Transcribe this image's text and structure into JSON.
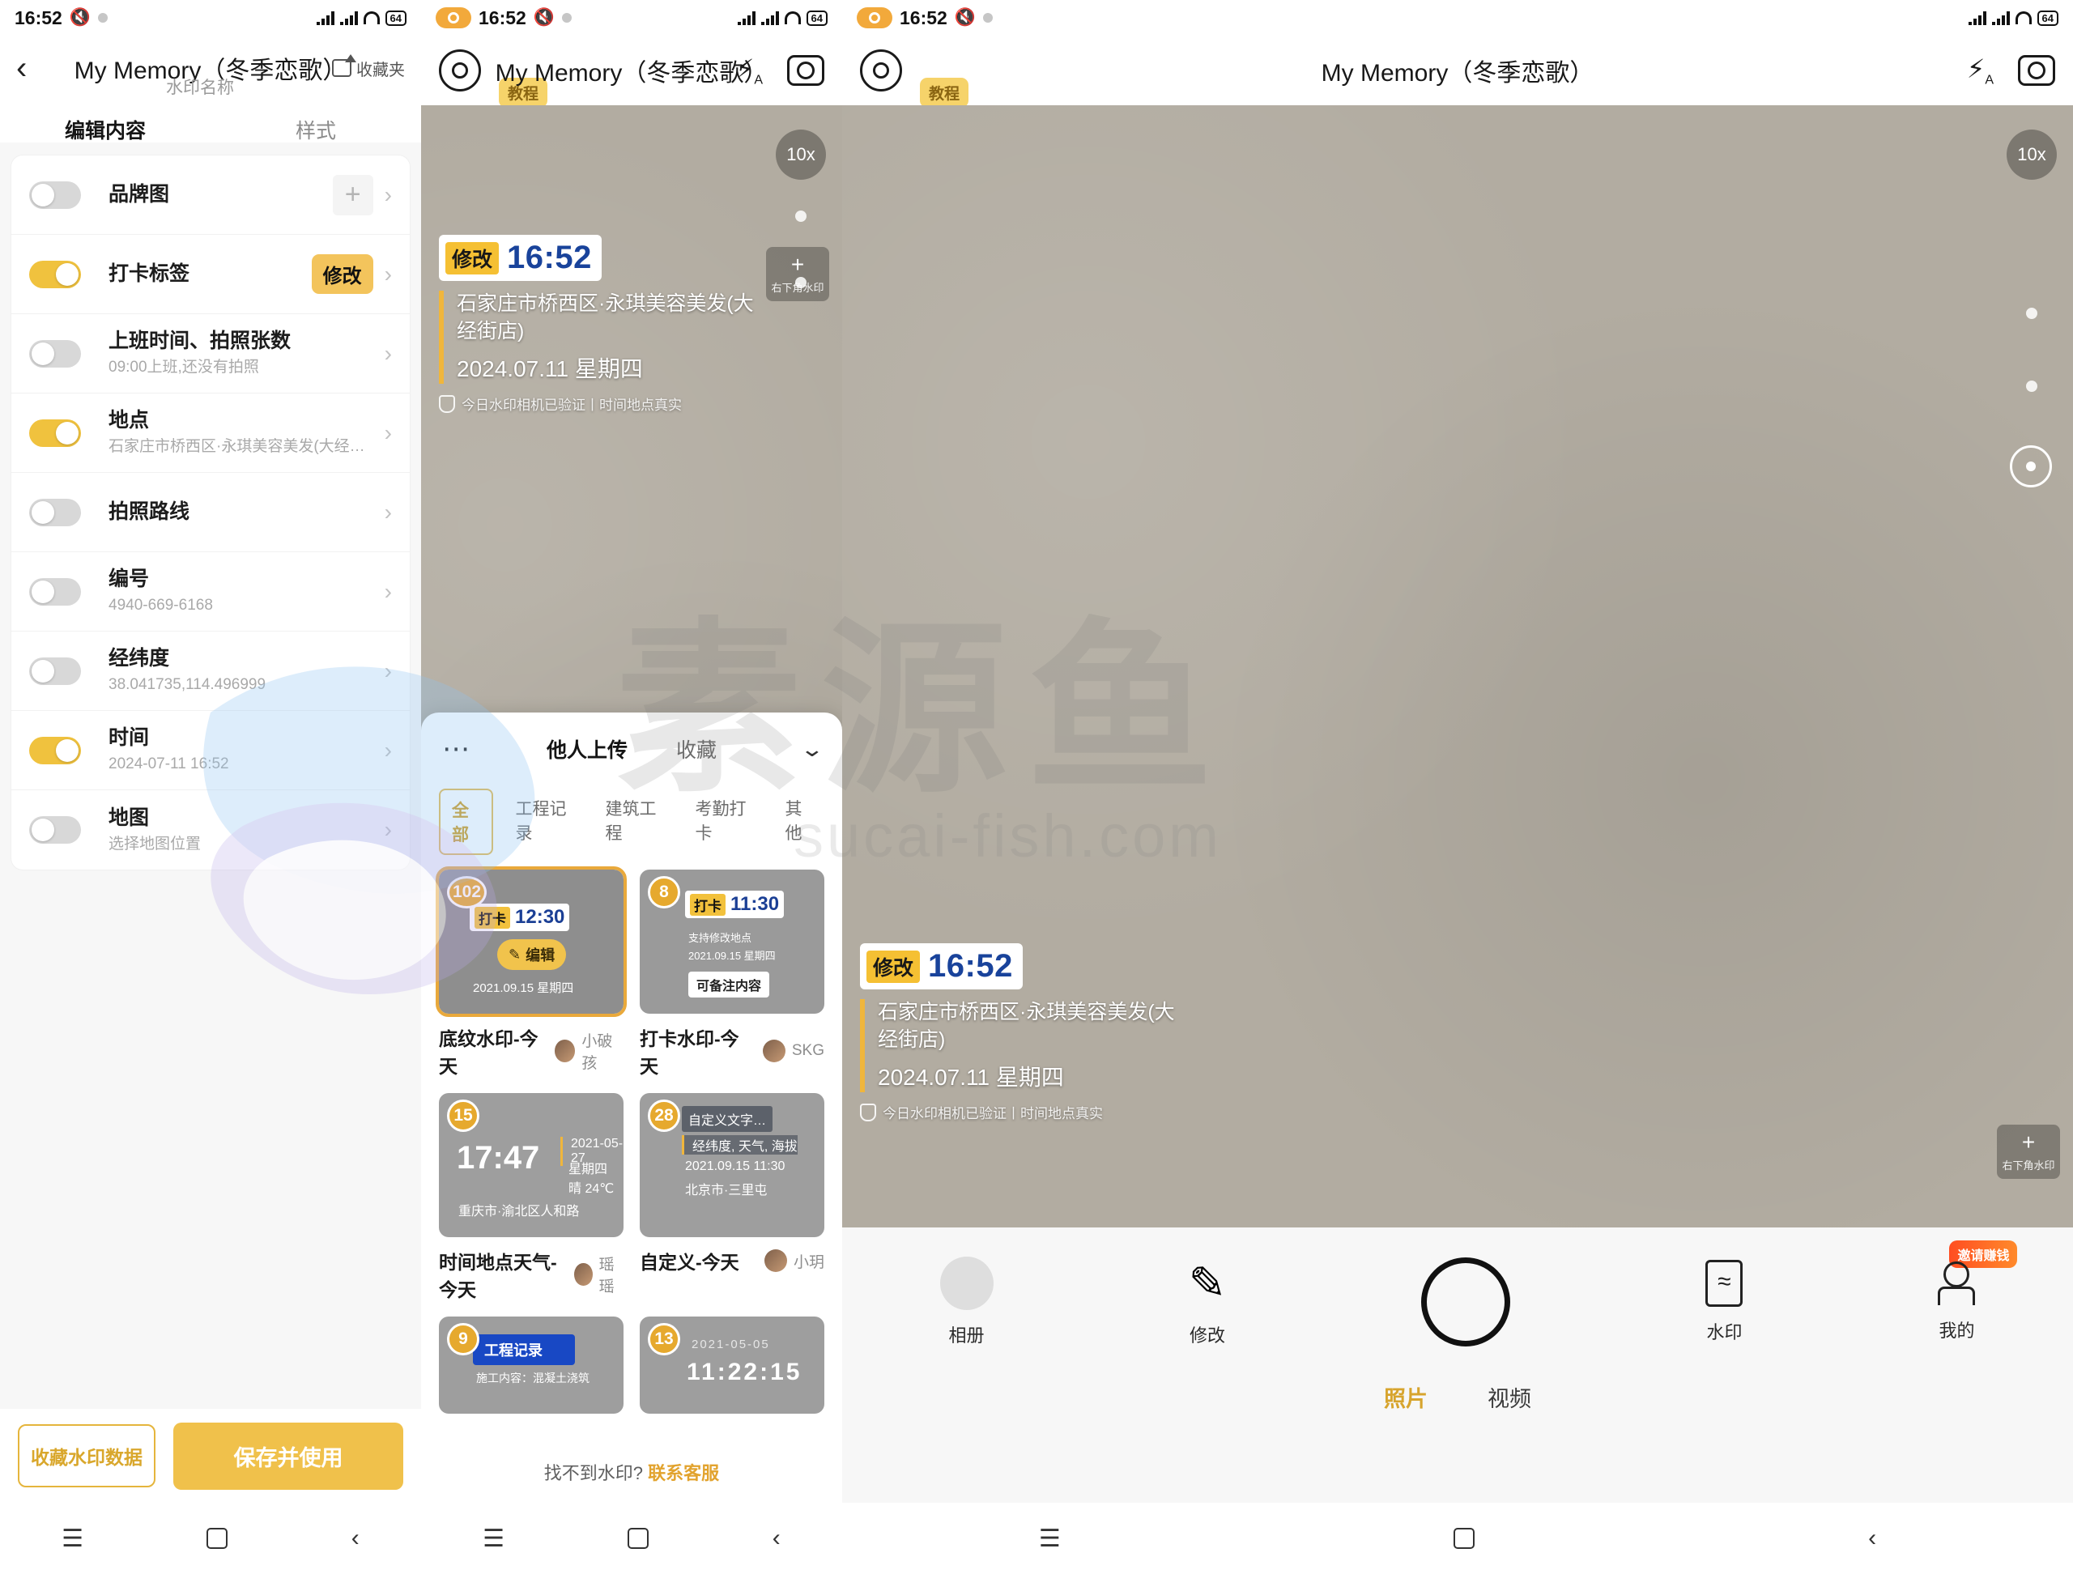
{
  "status_bar": {
    "time": "16:52",
    "mute_icon": "mute-icon",
    "battery": "64"
  },
  "left_panel": {
    "title": "My Memory（冬季恋歌）",
    "subtitle": "水印名称",
    "back_icon": "back-chevron-icon",
    "favorite_label": "收藏夹",
    "tabs": [
      {
        "label": "编辑内容",
        "active": true
      },
      {
        "label": "样式",
        "active": false
      }
    ],
    "rows": [
      {
        "title": "品牌图",
        "sub": "",
        "on": false,
        "trailing": "plus"
      },
      {
        "title": "打卡标签",
        "sub": "",
        "on": true,
        "trailing": "modify",
        "modify_label": "修改"
      },
      {
        "title": "上班时间、拍照张数",
        "sub": "09:00上班,还没有拍照",
        "on": false,
        "trailing": "none"
      },
      {
        "title": "地点",
        "sub": "石家庄市桥西区·永琪美容美发(大经街店)",
        "on": true,
        "trailing": "none"
      },
      {
        "title": "拍照路线",
        "sub": "",
        "on": false,
        "trailing": "none"
      },
      {
        "title": "编号",
        "sub": "4940-669-6168",
        "on": false,
        "trailing": "none"
      },
      {
        "title": "经纬度",
        "sub": "38.041735,114.496999",
        "on": false,
        "trailing": "none"
      },
      {
        "title": "时间",
        "sub": "2024-07-11 16:52",
        "on": true,
        "trailing": "none"
      },
      {
        "title": "地图",
        "sub": "选择地图位置",
        "on": false,
        "trailing": "none"
      }
    ],
    "actions": {
      "secondary": "收藏水印数据",
      "primary": "保存并使用"
    }
  },
  "middle_panel": {
    "title": "My Memory（冬季恋歌）",
    "tutorial_badge": "教程",
    "zoom_level": "10x",
    "add_watermark": {
      "plus": "+",
      "label": "右下角水印"
    },
    "watermark": {
      "tag": "修改",
      "time": "16:52",
      "location": "石家庄市桥西区·永琪美容美发(大经街店)",
      "date": "2024.07.11 星期四",
      "verify": "今日水印相机已验证丨时间地点真实"
    },
    "sheet": {
      "more_icon": "more-dots-icon",
      "tabs": [
        {
          "label": "他人上传",
          "active": true
        },
        {
          "label": "收藏",
          "active": false
        }
      ],
      "collapse_icon": "chevron-down-icon",
      "chips": [
        {
          "label": "全部",
          "active": true
        },
        {
          "label": "工程记录",
          "active": false
        },
        {
          "label": "建筑工程",
          "active": false
        },
        {
          "label": "考勤打卡",
          "active": false
        },
        {
          "label": "其他",
          "active": false
        }
      ],
      "cards": [
        {
          "num": "102",
          "name": "底纹水印-今天",
          "author": "小破孩",
          "selected": true,
          "preview": {
            "tag": "打卡",
            "time": "12:30",
            "date": "2021.09.15 星期四",
            "edit_label": "编辑"
          }
        },
        {
          "num": "8",
          "name": "打卡水印-今天",
          "author": "SKG",
          "selected": false,
          "preview": {
            "tag": "打卡",
            "time": "11:30",
            "line1": "支持修改地点",
            "line2": "2021.09.15 星期四",
            "note": "可备注内容"
          }
        },
        {
          "num": "15",
          "name": "时间地点天气-今天",
          "author": "瑶瑶",
          "selected": false,
          "preview": {
            "time": "17:47",
            "date": "2021-05-27",
            "weather": "星期四 晴 24℃",
            "place": "重庆市·渝北区人和路"
          }
        },
        {
          "num": "28",
          "name": "自定义-今天",
          "author": "小玥",
          "selected": false,
          "preview": {
            "custom": "自定义文字…",
            "line1": "经纬度, 天气, 海拔",
            "line2": "2021.09.15 11:30",
            "line3": "北京市·三里屯"
          }
        },
        {
          "num": "9",
          "name": "",
          "author": "",
          "selected": false,
          "preview": {
            "title": "工程记录",
            "line1": "施工内容：混凝土浇筑"
          }
        },
        {
          "num": "13",
          "name": "",
          "author": "",
          "selected": false,
          "preview": {
            "date": "2021-05-05",
            "time": "11:22:15"
          }
        }
      ],
      "footer_text": "找不到水印?",
      "footer_link": "联系客服"
    }
  },
  "right_panel": {
    "title": "My Memory（冬季恋歌）",
    "tutorial_badge": "教程",
    "zoom_level": "10x",
    "add_watermark": {
      "plus": "+",
      "label": "右下角水印"
    },
    "watermark": {
      "tag": "修改",
      "time": "16:52",
      "location": "石家庄市桥西区·永琪美容美发(大经街店)",
      "date": "2024.07.11 星期四",
      "verify": "今日水印相机已验证丨时间地点真实"
    },
    "tools": [
      {
        "label": "相册",
        "icon": "gallery-icon"
      },
      {
        "label": "修改",
        "icon": "pencil-icon"
      },
      {
        "label": "",
        "icon": "shutter-icon"
      },
      {
        "label": "水印",
        "icon": "watermark-icon"
      },
      {
        "label": "我的",
        "icon": "person-icon",
        "badge": "邀请赚钱"
      }
    ],
    "modes": [
      {
        "label": "照片",
        "active": true
      },
      {
        "label": "视频",
        "active": false
      }
    ]
  },
  "nav_bar": {
    "menu_icon": "menu-icon",
    "home_icon": "home-square-icon",
    "back_icon": "back-chevron-icon"
  },
  "page_watermark": {
    "big": "素源鱼",
    "sub": "sucai-fish.com"
  },
  "colors": {
    "accent": "#f0c14b",
    "accent_dark": "#d9a72c",
    "clock_blue": "#19439b",
    "viewfinder": "#b2aca1"
  }
}
